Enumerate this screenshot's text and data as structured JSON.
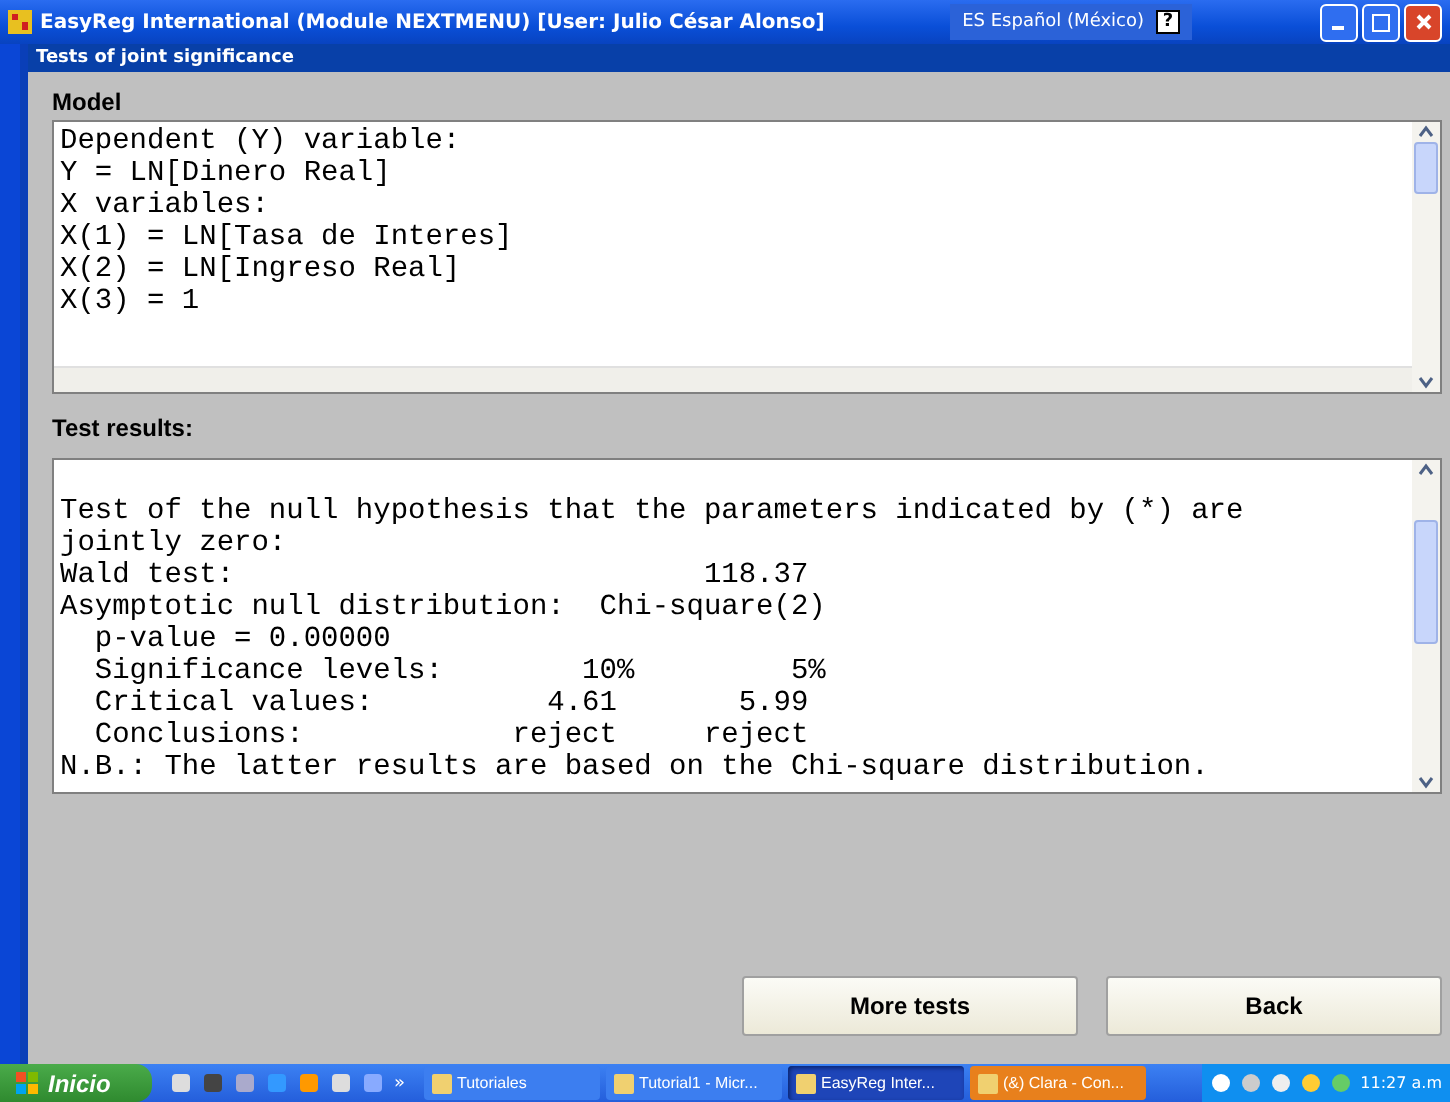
{
  "window": {
    "title": "EasyReg International (Module NEXTMENU) [User: Julio César Alonso]",
    "language_bar": "ES Español (México)",
    "help": "?"
  },
  "dialog": {
    "title": "Tests of joint significance"
  },
  "model": {
    "label": "Model",
    "lines": [
      "Dependent (Y) variable:",
      "Y = LN[Dinero Real]",
      "X variables:",
      "X(1) = LN[Tasa de Interes]",
      "X(2) = LN[Ingreso Real]",
      "X(3) = 1"
    ]
  },
  "results": {
    "label": "Test results:",
    "lines": [
      "Test of the null hypothesis that the parameters indicated by (*) are",
      "jointly zero:",
      "Wald test:                           118.37",
      "Asymptotic null distribution:  Chi-square(2)",
      "  p-value = 0.00000",
      "  Significance levels:        10%         5%",
      "  Critical values:          4.61       5.99",
      "  Conclusions:            reject     reject",
      "N.B.: The latter results are based on the Chi-square distribution."
    ]
  },
  "buttons": [
    "More tests",
    "Back"
  ],
  "taskbar": {
    "start": "Inicio",
    "chevron": "»",
    "tasks": [
      {
        "label": "Tutoriales",
        "selected": false,
        "flashing": false
      },
      {
        "label": "Tutorial1 - Micr...",
        "selected": false,
        "flashing": false
      },
      {
        "label": "EasyReg Inter...",
        "selected": true,
        "flashing": false
      },
      {
        "label": "(&) Clara - Con...",
        "selected": false,
        "flashing": true
      }
    ],
    "clock": "11:27 a.m"
  }
}
